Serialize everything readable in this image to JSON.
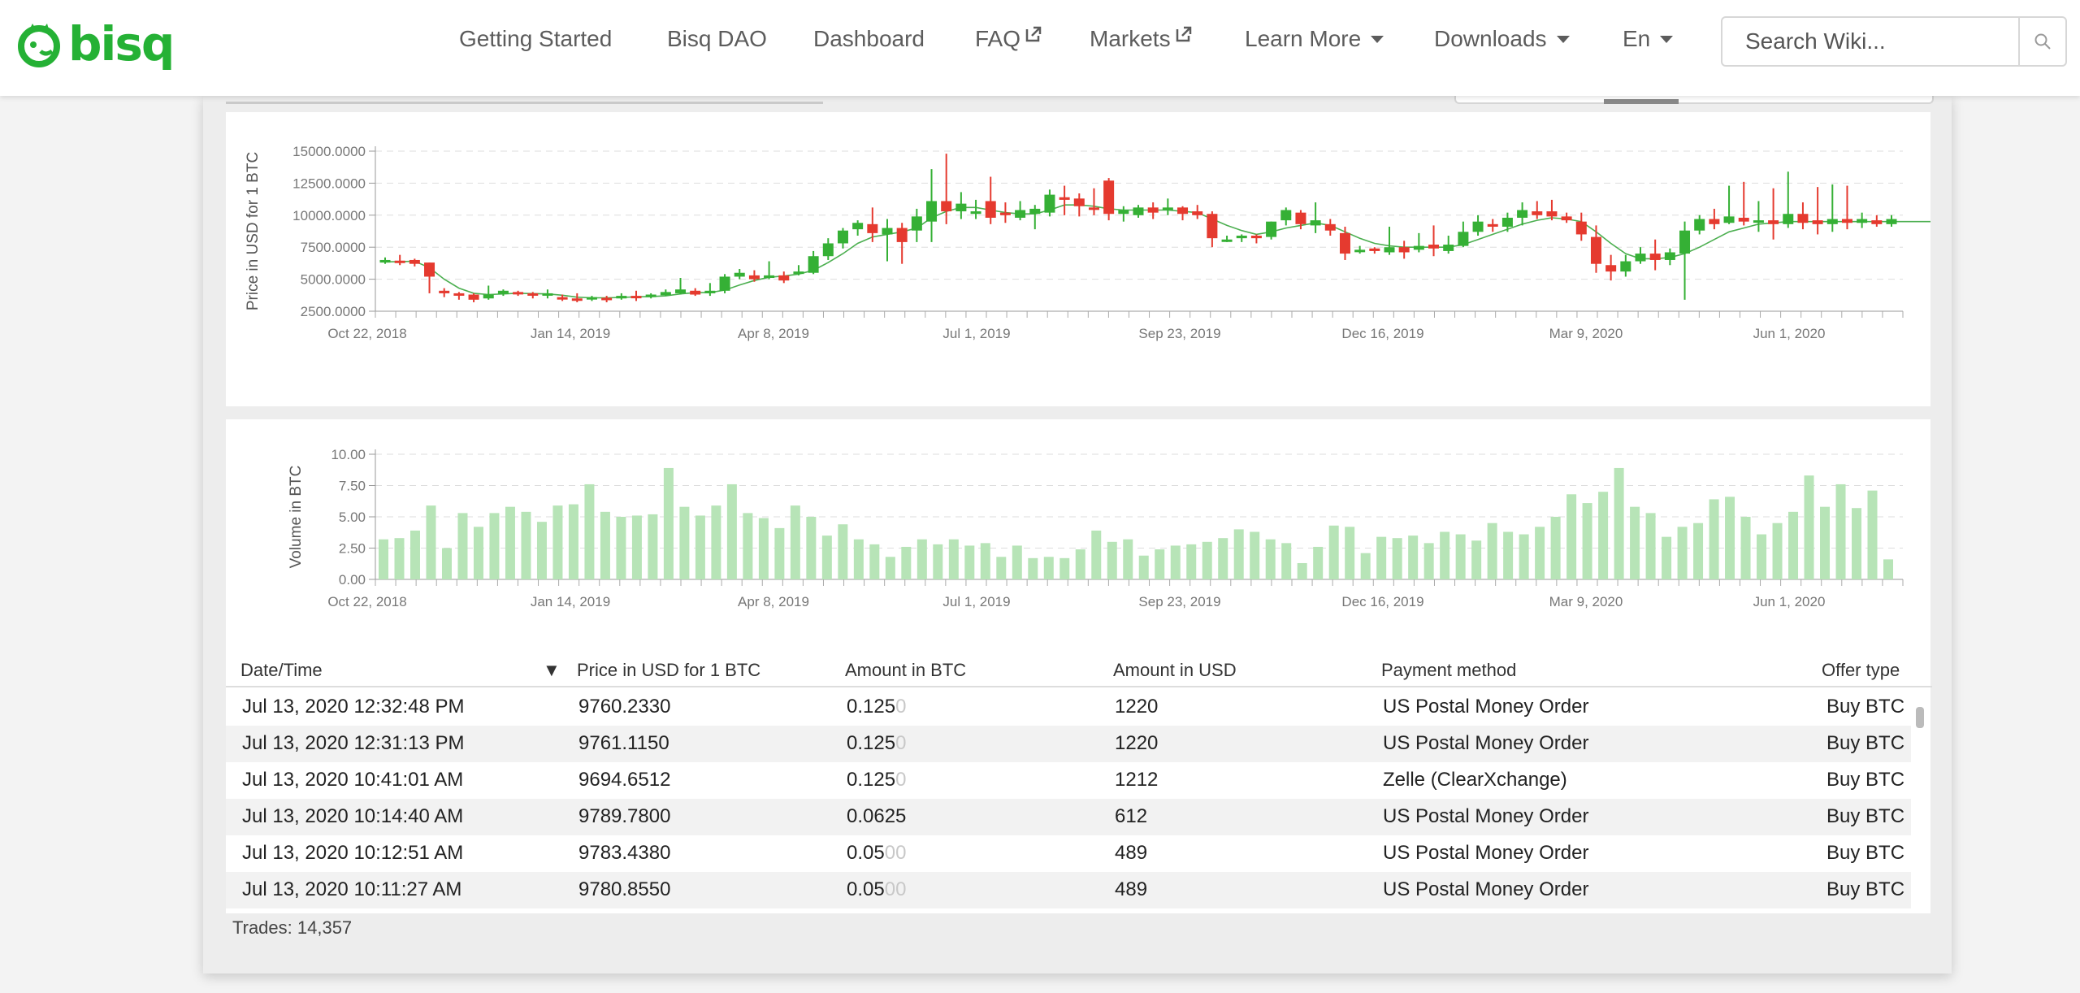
{
  "brand": {
    "name": "bisq",
    "color": "#25b135"
  },
  "nav": {
    "items": [
      {
        "label": "Getting Started",
        "type": "link"
      },
      {
        "label": "Bisq DAO",
        "type": "link"
      },
      {
        "label": "Dashboard",
        "type": "link"
      },
      {
        "label": "FAQ",
        "type": "external"
      },
      {
        "label": "Markets",
        "type": "external"
      },
      {
        "label": "Learn More",
        "type": "dropdown"
      },
      {
        "label": "Downloads",
        "type": "dropdown"
      },
      {
        "label": "En",
        "type": "dropdown"
      }
    ],
    "search": {
      "placeholder": "Search Wiki..."
    }
  },
  "colors": {
    "up": "#35b035",
    "down": "#e53a2f",
    "volume": "#b7e4b7",
    "ma_line": "#4caf50"
  },
  "price_chart": {
    "ylabel": "Price in USD for 1 BTC",
    "y_ticks": [
      "15000.0000",
      "12500.0000",
      "10000.0000",
      "7500.0000",
      "5000.0000",
      "2500.0000"
    ],
    "x_ticks": [
      "Oct 22, 2018",
      "Jan 14, 2019",
      "Apr 8, 2019",
      "Jul 1, 2019",
      "Sep 23, 2019",
      "Dec 16, 2019",
      "Mar 9, 2020",
      "Jun 1, 2020"
    ]
  },
  "volume_chart": {
    "ylabel": "Volume in BTC",
    "y_ticks": [
      "10.00",
      "7.50",
      "5.00",
      "2.50",
      "0.00"
    ],
    "x_ticks": [
      "Oct 22, 2018",
      "Jan 14, 2019",
      "Apr 8, 2019",
      "Jul 1, 2019",
      "Sep 23, 2019",
      "Dec 16, 2019",
      "Mar 9, 2020",
      "Jun 1, 2020"
    ]
  },
  "chart_data": [
    {
      "type": "candlestick",
      "ylabel": "Price in USD for 1 BTC",
      "ylim": [
        2500,
        15000
      ],
      "x_start": "Oct 22, 2018",
      "x_end": "Jul 13, 2020",
      "ohlc": [
        [
          6300,
          6500,
          6200,
          6700
        ],
        [
          6450,
          6300,
          6100,
          6900
        ],
        [
          6500,
          6200,
          6000,
          6600
        ],
        [
          6300,
          5200,
          3900,
          6300
        ],
        [
          4100,
          3900,
          3600,
          4300
        ],
        [
          3900,
          3800,
          3400,
          4000
        ],
        [
          3800,
          3400,
          3200,
          3900
        ],
        [
          3500,
          3800,
          3400,
          4500
        ],
        [
          3850,
          4100,
          3700,
          4200
        ],
        [
          4000,
          3850,
          3700,
          4100
        ],
        [
          3900,
          3750,
          3500,
          4000
        ],
        [
          3750,
          3900,
          3500,
          4200
        ],
        [
          3600,
          3500,
          3300,
          3800
        ],
        [
          3500,
          3400,
          3200,
          3900
        ],
        [
          3500,
          3600,
          3300,
          3700
        ],
        [
          3550,
          3400,
          3200,
          3700
        ],
        [
          3500,
          3700,
          3400,
          3900
        ],
        [
          3700,
          3550,
          3300,
          4100
        ],
        [
          3600,
          3800,
          3500,
          3900
        ],
        [
          3750,
          4000,
          3700,
          4200
        ],
        [
          3900,
          4200,
          3800,
          5100
        ],
        [
          4100,
          3800,
          3700,
          4300
        ],
        [
          3900,
          4100,
          3700,
          4700
        ],
        [
          4100,
          5200,
          3900,
          5400
        ],
        [
          5200,
          5500,
          5000,
          5800
        ],
        [
          5300,
          5000,
          4800,
          5700
        ],
        [
          5100,
          5300,
          5000,
          6400
        ],
        [
          5300,
          4900,
          4700,
          5600
        ],
        [
          5500,
          5600,
          5300,
          6100
        ],
        [
          5500,
          6800,
          5400,
          7200
        ],
        [
          6800,
          7800,
          6500,
          8200
        ],
        [
          7800,
          8800,
          7400,
          9000
        ],
        [
          8900,
          9400,
          8400,
          9600
        ],
        [
          9300,
          8600,
          7900,
          10600
        ],
        [
          8500,
          9000,
          6400,
          9700
        ],
        [
          9000,
          7900,
          6200,
          9400
        ],
        [
          8800,
          9900,
          7900,
          10500
        ],
        [
          9500,
          11100,
          7900,
          13600
        ],
        [
          11100,
          10300,
          9300,
          14800
        ],
        [
          10300,
          10900,
          9700,
          11800
        ],
        [
          10100,
          10300,
          9700,
          11200
        ],
        [
          11100,
          9800,
          9300,
          13000
        ],
        [
          10200,
          10000,
          9400,
          11000
        ],
        [
          9800,
          10400,
          9600,
          11100
        ],
        [
          10100,
          10500,
          8900,
          10800
        ],
        [
          10200,
          11600,
          9900,
          12000
        ],
        [
          11400,
          11200,
          10000,
          12300
        ],
        [
          11300,
          10700,
          9900,
          11700
        ],
        [
          10600,
          10500,
          10000,
          12100
        ],
        [
          12700,
          10100,
          9600,
          12900
        ],
        [
          10100,
          10400,
          9500,
          10700
        ],
        [
          10000,
          10600,
          9800,
          10800
        ],
        [
          10600,
          10200,
          9700,
          11000
        ],
        [
          10400,
          10600,
          10000,
          11300
        ],
        [
          10600,
          10100,
          9600,
          10700
        ],
        [
          10300,
          10000,
          9700,
          10800
        ],
        [
          10100,
          8200,
          7500,
          10300
        ],
        [
          8000,
          8100,
          7900,
          8400
        ],
        [
          8200,
          8400,
          7900,
          8500
        ],
        [
          8400,
          8200,
          7800,
          8500
        ],
        [
          8300,
          9500,
          8100,
          9500
        ],
        [
          9600,
          10400,
          9200,
          10600
        ],
        [
          10200,
          9300,
          8900,
          10400
        ],
        [
          9200,
          9600,
          8600,
          11000
        ],
        [
          9300,
          8800,
          8400,
          9700
        ],
        [
          8600,
          7000,
          6500,
          9100
        ],
        [
          7200,
          7300,
          7000,
          7600
        ],
        [
          7400,
          7200,
          7000,
          7500
        ],
        [
          7100,
          7500,
          6900,
          9100
        ],
        [
          7500,
          7100,
          6600,
          8000
        ],
        [
          7300,
          7600,
          7100,
          8600
        ],
        [
          7700,
          7400,
          6800,
          9200
        ],
        [
          7200,
          7700,
          7000,
          8400
        ],
        [
          7600,
          8700,
          7500,
          9500
        ],
        [
          8700,
          9500,
          8400,
          10000
        ],
        [
          9300,
          9100,
          8700,
          9700
        ],
        [
          9100,
          9800,
          8700,
          10200
        ],
        [
          9800,
          10400,
          9200,
          11000
        ],
        [
          10300,
          10000,
          9700,
          11100
        ],
        [
          10300,
          9900,
          9600,
          11200
        ],
        [
          9900,
          9600,
          9400,
          10200
        ],
        [
          9500,
          8500,
          8000,
          10200
        ],
        [
          8300,
          6200,
          5500,
          9200
        ],
        [
          6100,
          5600,
          4900,
          6900
        ],
        [
          5600,
          6400,
          5200,
          6900
        ],
        [
          6400,
          7000,
          6200,
          7500
        ],
        [
          7000,
          6500,
          5700,
          8100
        ],
        [
          6500,
          7100,
          6100,
          7400
        ],
        [
          7000,
          8800,
          3400,
          9500
        ],
        [
          8800,
          9700,
          8500,
          10000
        ],
        [
          9700,
          9300,
          8900,
          10500
        ],
        [
          9400,
          9900,
          9300,
          12300
        ],
        [
          9800,
          9500,
          9200,
          12600
        ],
        [
          9500,
          9600,
          8700,
          11100
        ],
        [
          9600,
          9300,
          8100,
          12100
        ],
        [
          9300,
          10100,
          9000,
          13400
        ],
        [
          10100,
          9400,
          8900,
          11000
        ],
        [
          9600,
          9300,
          8500,
          12200
        ],
        [
          9300,
          9700,
          8700,
          12400
        ],
        [
          9700,
          9400,
          8900,
          12300
        ],
        [
          9400,
          9700,
          9000,
          10200
        ],
        [
          9600,
          9300,
          9100,
          10000
        ],
        [
          9300,
          9700,
          9100,
          10000
        ]
      ],
      "moving_average": [
        6350,
        6380,
        6400,
        5900,
        5000,
        4300,
        3900,
        3800,
        3850,
        3900,
        3880,
        3850,
        3750,
        3600,
        3550,
        3550,
        3580,
        3620,
        3650,
        3700,
        3850,
        3950,
        3950,
        4150,
        4550,
        4900,
        5150,
        5250,
        5400,
        5700,
        6300,
        7000,
        7800,
        8300,
        8500,
        8700,
        9000,
        9800,
        10300,
        10600,
        10600,
        10400,
        10200,
        10100,
        10100,
        10400,
        10800,
        10800,
        10700,
        10500,
        10400,
        10400,
        10400,
        10400,
        10300,
        10200,
        9700,
        9200,
        8800,
        8500,
        8700,
        9000,
        9200,
        9400,
        9200,
        8700,
        8200,
        7800,
        7600,
        7500,
        7500,
        7500,
        7500,
        7700,
        8100,
        8500,
        8900,
        9300,
        9600,
        9800,
        9700,
        9500,
        8700,
        7800,
        7000,
        6600,
        6600,
        6700,
        7000,
        7500,
        8100,
        8700,
        9000,
        9300,
        9400,
        9500,
        9500,
        9500,
        9500,
        9500,
        9500,
        9500,
        9500,
        9500,
        9500,
        9500
      ]
    },
    {
      "type": "bar",
      "ylabel": "Volume in BTC",
      "ylim": [
        0,
        10
      ],
      "values": [
        3.2,
        3.3,
        3.9,
        5.9,
        2.5,
        5.3,
        4.2,
        5.3,
        5.8,
        5.4,
        4.6,
        5.9,
        6.0,
        7.6,
        5.4,
        5.0,
        5.1,
        5.2,
        8.9,
        5.8,
        5.1,
        5.9,
        7.6,
        5.3,
        4.9,
        4.1,
        5.9,
        5.0,
        3.5,
        4.4,
        3.2,
        2.8,
        1.8,
        2.6,
        3.2,
        2.8,
        3.2,
        2.7,
        2.9,
        1.8,
        2.7,
        1.7,
        1.8,
        1.7,
        2.4,
        3.9,
        3.0,
        3.2,
        1.9,
        2.4,
        2.7,
        2.8,
        3.0,
        3.3,
        4.0,
        3.8,
        3.2,
        2.9,
        1.3,
        2.6,
        4.3,
        4.2,
        2.1,
        3.4,
        3.3,
        3.5,
        2.9,
        3.8,
        3.6,
        3.1,
        4.5,
        3.8,
        3.6,
        4.2,
        5.0,
        6.8,
        6.1,
        7.0,
        8.9,
        5.8,
        5.3,
        3.4,
        4.2,
        4.5,
        6.4,
        6.6,
        5.0,
        3.6,
        4.5,
        5.4,
        8.3,
        5.8,
        7.6,
        5.7,
        7.1,
        1.6
      ]
    }
  ],
  "table": {
    "columns": [
      "Date/Time",
      "Price in USD for 1 BTC",
      "Amount in BTC",
      "Amount in USD",
      "Payment method",
      "Offer type"
    ],
    "rows": [
      {
        "date": "Jul 13, 2020 12:32:48 PM",
        "price": "9760.2330",
        "amount": "0.125",
        "amount_dim": "0",
        "usd": "1220",
        "method": "US Postal Money Order",
        "offer": "Buy BTC"
      },
      {
        "date": "Jul 13, 2020 12:31:13 PM",
        "price": "9761.1150",
        "amount": "0.125",
        "amount_dim": "0",
        "usd": "1220",
        "method": "US Postal Money Order",
        "offer": "Buy BTC"
      },
      {
        "date": "Jul 13, 2020 10:41:01 AM",
        "price": "9694.6512",
        "amount": "0.125",
        "amount_dim": "0",
        "usd": "1212",
        "method": "Zelle (ClearXchange)",
        "offer": "Buy BTC"
      },
      {
        "date": "Jul 13, 2020 10:14:40 AM",
        "price": "9789.7800",
        "amount": "0.0625",
        "amount_dim": "",
        "usd": "612",
        "method": "US Postal Money Order",
        "offer": "Buy BTC"
      },
      {
        "date": "Jul 13, 2020 10:12:51 AM",
        "price": "9783.4380",
        "amount": "0.05",
        "amount_dim": "00",
        "usd": "489",
        "method": "US Postal Money Order",
        "offer": "Buy BTC"
      },
      {
        "date": "Jul 13, 2020 10:11:27 AM",
        "price": "9780.8550",
        "amount": "0.05",
        "amount_dim": "00",
        "usd": "489",
        "method": "US Postal Money Order",
        "offer": "Buy BTC"
      }
    ],
    "trades_label": "Trades: 14,357"
  }
}
